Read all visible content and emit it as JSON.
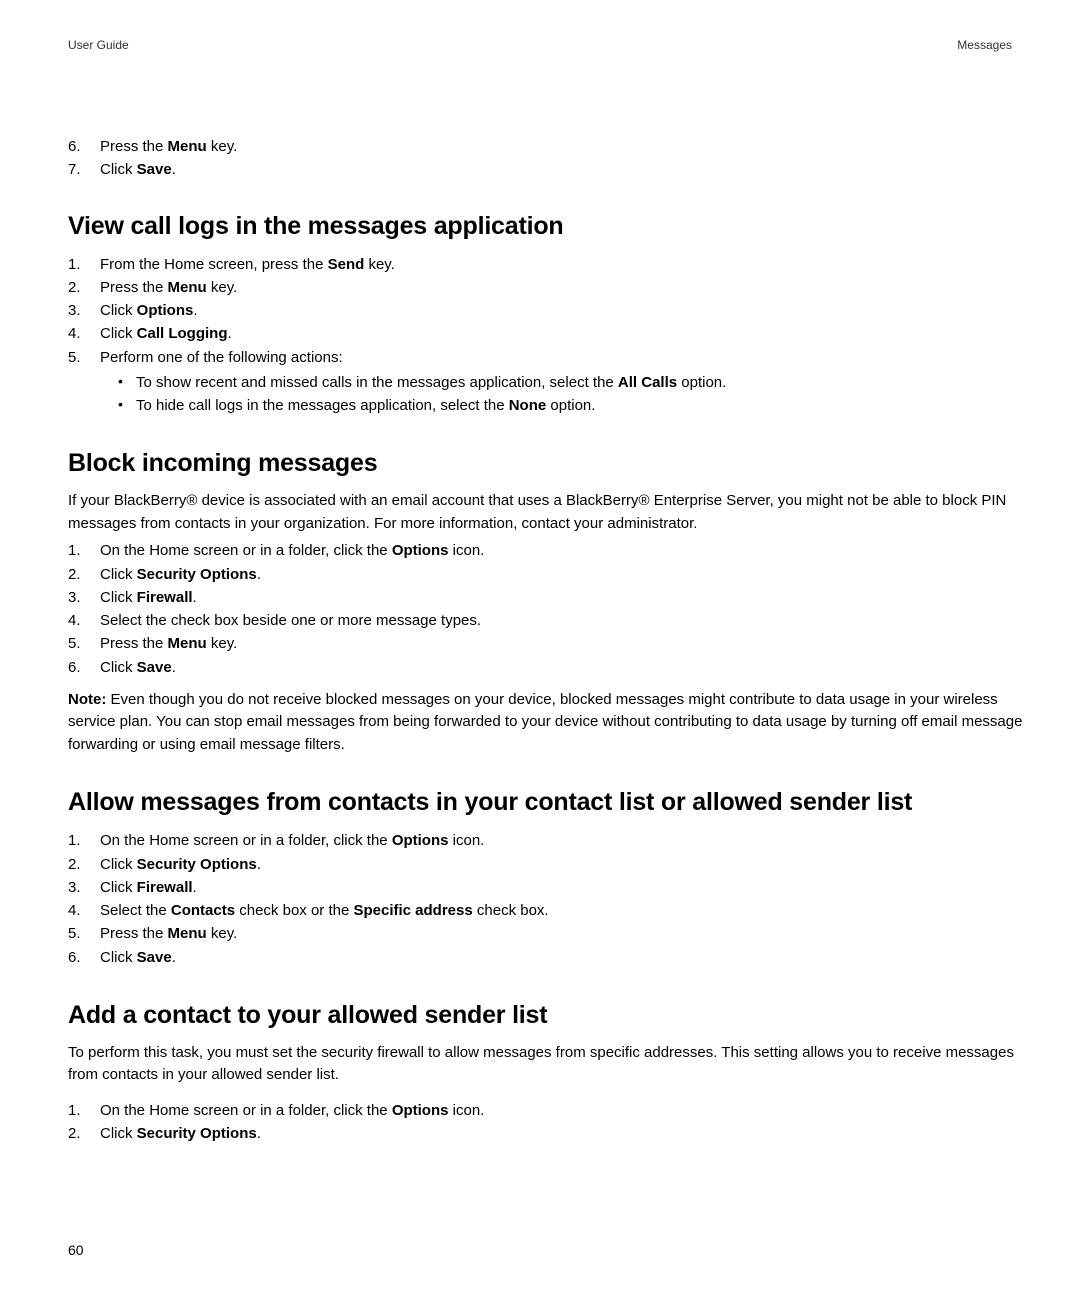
{
  "header": {
    "left": "User Guide",
    "right": "Messages"
  },
  "topList": {
    "item6_pre": "Press the ",
    "item6_bold": "Menu",
    "item6_post": " key.",
    "item7_pre": "Click ",
    "item7_bold": "Save",
    "item7_post": "."
  },
  "section1": {
    "heading": "View call logs in the messages application",
    "items": {
      "i1_pre": "From the Home screen, press the ",
      "i1_bold": "Send",
      "i1_post": " key.",
      "i2_pre": "Press the ",
      "i2_bold": "Menu",
      "i2_post": " key.",
      "i3_pre": "Click ",
      "i3_bold": "Options",
      "i3_post": ".",
      "i4_pre": "Click ",
      "i4_bold": "Call Logging",
      "i4_post": ".",
      "i5_text": "Perform one of the following actions:",
      "b1_pre": "To show recent and missed calls in the messages application, select the ",
      "b1_bold": "All Calls",
      "b1_post": " option.",
      "b2_pre": "To hide call logs in the messages application, select the ",
      "b2_bold": "None",
      "b2_post": " option."
    }
  },
  "section2": {
    "heading": "Block incoming messages",
    "para": "If your BlackBerry® device is associated with an email account that uses a BlackBerry® Enterprise Server, you might not be able to block PIN messages from contacts in your organization. For more information, contact your administrator.",
    "items": {
      "i1_pre": "On the Home screen or in a folder, click the ",
      "i1_bold": "Options",
      "i1_post": " icon.",
      "i2_pre": "Click ",
      "i2_bold": "Security Options",
      "i2_post": ".",
      "i3_pre": "Click ",
      "i3_bold": "Firewall",
      "i3_post": ".",
      "i4_text": "Select the check box beside one or more message types.",
      "i5_pre": "Press the ",
      "i5_bold": "Menu",
      "i5_post": " key.",
      "i6_pre": "Click ",
      "i6_bold": "Save",
      "i6_post": "."
    },
    "note_label": "Note:",
    "note_text": "  Even though you do not receive blocked messages on your device, blocked messages might contribute to data usage in your wireless service plan. You can stop email messages from being forwarded to your device without contributing to data usage by turning off email message forwarding or using email message filters."
  },
  "section3": {
    "heading": "Allow messages from contacts in your contact list or allowed sender list",
    "items": {
      "i1_pre": "On the Home screen or in a folder, click the ",
      "i1_bold": "Options",
      "i1_post": " icon.",
      "i2_pre": "Click ",
      "i2_bold": "Security Options",
      "i2_post": ".",
      "i3_pre": "Click ",
      "i3_bold": "Firewall",
      "i3_post": ".",
      "i4_pre": "Select the ",
      "i4_bold": "Contacts",
      "i4_mid": " check box or the ",
      "i4_bold2": "Specific address",
      "i4_post": " check box.",
      "i5_pre": "Press the ",
      "i5_bold": "Menu",
      "i5_post": " key.",
      "i6_pre": "Click ",
      "i6_bold": "Save",
      "i6_post": "."
    }
  },
  "section4": {
    "heading": "Add a contact to your allowed sender list",
    "para": "To perform this task, you must set the security firewall to allow messages from specific addresses. This setting allows you to receive messages from contacts in your allowed sender list.",
    "items": {
      "i1_pre": "On the Home screen or in a folder, click the ",
      "i1_bold": "Options",
      "i1_post": " icon.",
      "i2_pre": "Click ",
      "i2_bold": "Security Options",
      "i2_post": "."
    }
  },
  "pageNumber": "60"
}
